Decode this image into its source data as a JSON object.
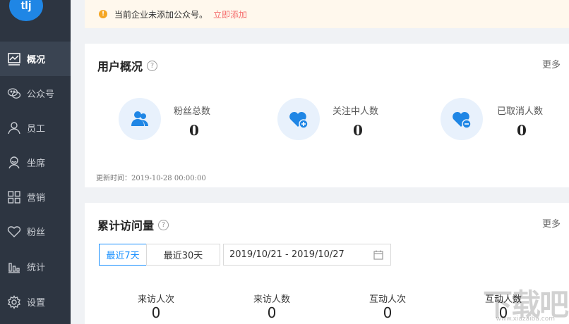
{
  "logo": {
    "text": "tlj"
  },
  "sidebar": {
    "items": [
      {
        "label": "概况",
        "icon": "chart-icon",
        "active": true
      },
      {
        "label": "公众号",
        "icon": "wechat-icon",
        "active": false
      },
      {
        "label": "员工",
        "icon": "user-icon",
        "active": false
      },
      {
        "label": "坐席",
        "icon": "headset-icon",
        "active": false
      },
      {
        "label": "营销",
        "icon": "grid-icon",
        "active": false
      },
      {
        "label": "粉丝",
        "icon": "heart-icon",
        "active": false
      },
      {
        "label": "统计",
        "icon": "bar-chart-icon",
        "active": false
      },
      {
        "label": "设置",
        "icon": "gear-icon",
        "active": false
      }
    ]
  },
  "notice": {
    "text": "当前企业未添加公众号。",
    "link": "立即添加"
  },
  "user_overview": {
    "title": "用户概况",
    "more": "更多",
    "stats": [
      {
        "label": "粉丝总数",
        "value": "0",
        "icon": "users-icon"
      },
      {
        "label": "关注中人数",
        "value": "0",
        "icon": "heart-plus-icon"
      },
      {
        "label": "已取消人数",
        "value": "0",
        "icon": "heart-minus-icon"
      }
    ],
    "update_time": "更新时间：2019-10-28 00:00:00"
  },
  "visits": {
    "title": "累计访问量",
    "more": "更多",
    "tabs": [
      {
        "label": "最近7天",
        "active": true
      },
      {
        "label": "最近30天",
        "active": false
      }
    ],
    "date_range": "2019/10/21 - 2019/10/27",
    "metrics": [
      {
        "label": "来访人次",
        "value": "0"
      },
      {
        "label": "来访人数",
        "value": "0"
      },
      {
        "label": "互动人次",
        "value": "0"
      },
      {
        "label": "互动人数",
        "value": "0"
      }
    ]
  },
  "watermark": {
    "text": "下载吧",
    "url": "www.xiazaiba.com"
  },
  "colors": {
    "primary": "#1890ff",
    "sidebar": "#2d3541",
    "icon_blue": "#1f86e5",
    "notice_bg": "#fff8ed",
    "link": "#f56c6c"
  }
}
